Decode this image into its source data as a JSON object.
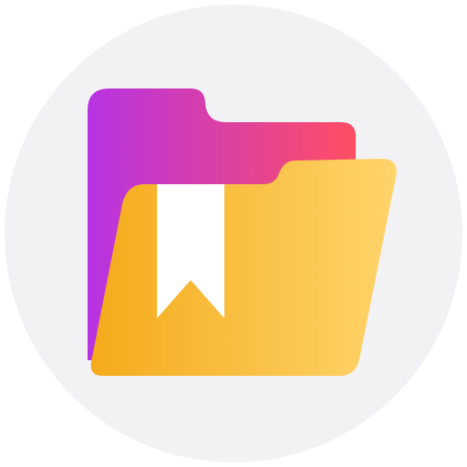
{
  "icon": {
    "name": "bookmark-folder-icon",
    "colors": {
      "background_circle": "#f2f2f4",
      "back_folder_gradient_start": "#b733e3",
      "back_folder_gradient_end": "#ff4e63",
      "front_folder_gradient_start": "#f4ab1b",
      "front_folder_gradient_end": "#ffd46b",
      "bookmark": "#ffffff"
    }
  }
}
